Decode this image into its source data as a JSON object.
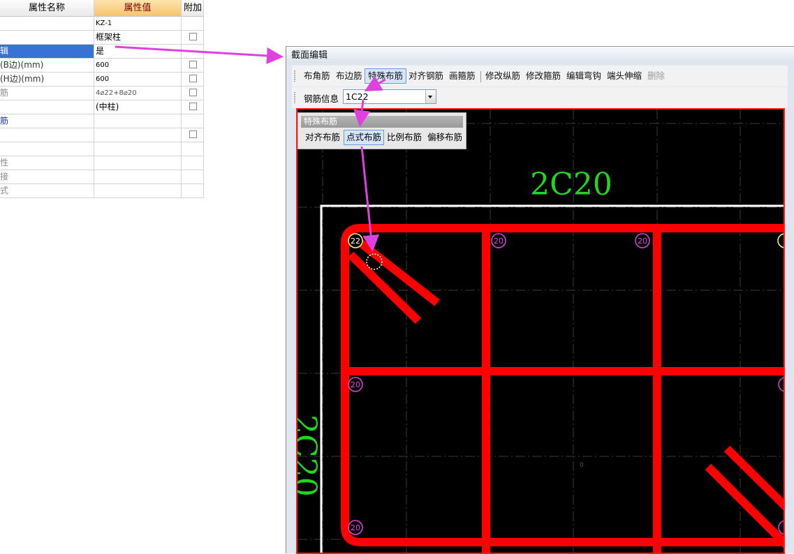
{
  "property_grid": {
    "headers": {
      "name": "属性名称",
      "value": "属性值",
      "extra": "附加"
    },
    "rows": [
      {
        "name": "",
        "value": "KZ-1",
        "checkbox": false
      },
      {
        "name": "",
        "value": "框架柱",
        "checkbox": true
      },
      {
        "name": "辑",
        "value": "是",
        "checkbox": false,
        "selected": true
      },
      {
        "name": "(B边)(mm)",
        "value": "600",
        "checkbox": true
      },
      {
        "name": "(H边)(mm)",
        "value": "600",
        "checkbox": true
      },
      {
        "name": "筋",
        "value": "4⌀22+8⌀20",
        "checkbox": true
      },
      {
        "name": "",
        "value": "(中柱)",
        "checkbox": true
      },
      {
        "name": "筋",
        "value": "",
        "checkbox": false
      },
      {
        "name": "",
        "value": "",
        "checkbox": true
      },
      {
        "name": "",
        "value": "",
        "checkbox": false
      },
      {
        "name": "性",
        "value": "",
        "checkbox": false
      },
      {
        "name": "接",
        "value": "",
        "checkbox": false
      },
      {
        "name": "式",
        "value": "",
        "checkbox": false
      }
    ]
  },
  "editor": {
    "title": "截面编辑",
    "toolbar": [
      "布角筋",
      "布边筋",
      "特殊布筋",
      "对齐钢筋",
      "画箍筋",
      "修改纵筋",
      "修改箍筋",
      "编辑弯钩",
      "端头伸缩",
      "删除"
    ],
    "active_tool": "特殊布筋",
    "disabled_tool": "删除",
    "rebar_info_label": "钢筋信息",
    "rebar_info_value": "1C22"
  },
  "popup": {
    "title": "特殊布筋",
    "buttons": [
      "对齐布筋",
      "点式布筋",
      "比例布筋",
      "偏移布筋"
    ],
    "active": "点式布筋"
  },
  "canvas": {
    "top_label": "2C20",
    "left_label": "2C20",
    "center_marker": "0",
    "corner_bar_label": "22",
    "side_bar_label": "20",
    "colors": {
      "background": "#000000",
      "stirrup": "#ff0000",
      "section_outline": "#ffffff",
      "text_label": "#1ed81e",
      "corner_bar": "#ffff66",
      "side_bar": "#e040e0",
      "arrow": "#e040e0"
    }
  }
}
